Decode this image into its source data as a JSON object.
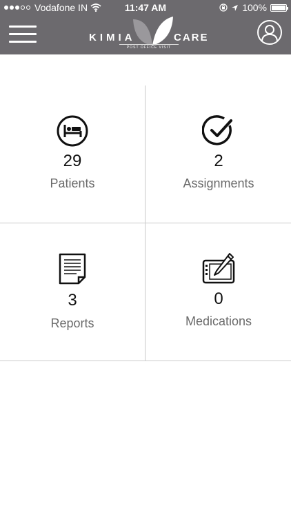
{
  "status_bar": {
    "carrier": "Vodafone IN",
    "time": "11:47 AM",
    "battery": "100%"
  },
  "header": {
    "logo_left": "KIMIA",
    "logo_right": "CARE",
    "logo_tagline": "POST OFFICE VISIT",
    "menu_icon": "hamburger-menu-icon",
    "profile_icon": "user-profile-icon"
  },
  "dashboard": {
    "tiles": [
      {
        "count": "29",
        "label": "Patients",
        "icon": "hospital-bed-icon"
      },
      {
        "count": "2",
        "label": "Assignments",
        "icon": "checkmark-circle-icon"
      },
      {
        "count": "3",
        "label": "Reports",
        "icon": "document-icon"
      },
      {
        "count": "0",
        "label": "Medications",
        "icon": "tablet-pen-icon"
      }
    ]
  },
  "colors": {
    "header_bg": "#6c6a6e",
    "divider": "#c9c9c9",
    "label_text": "#6a6a6a"
  }
}
